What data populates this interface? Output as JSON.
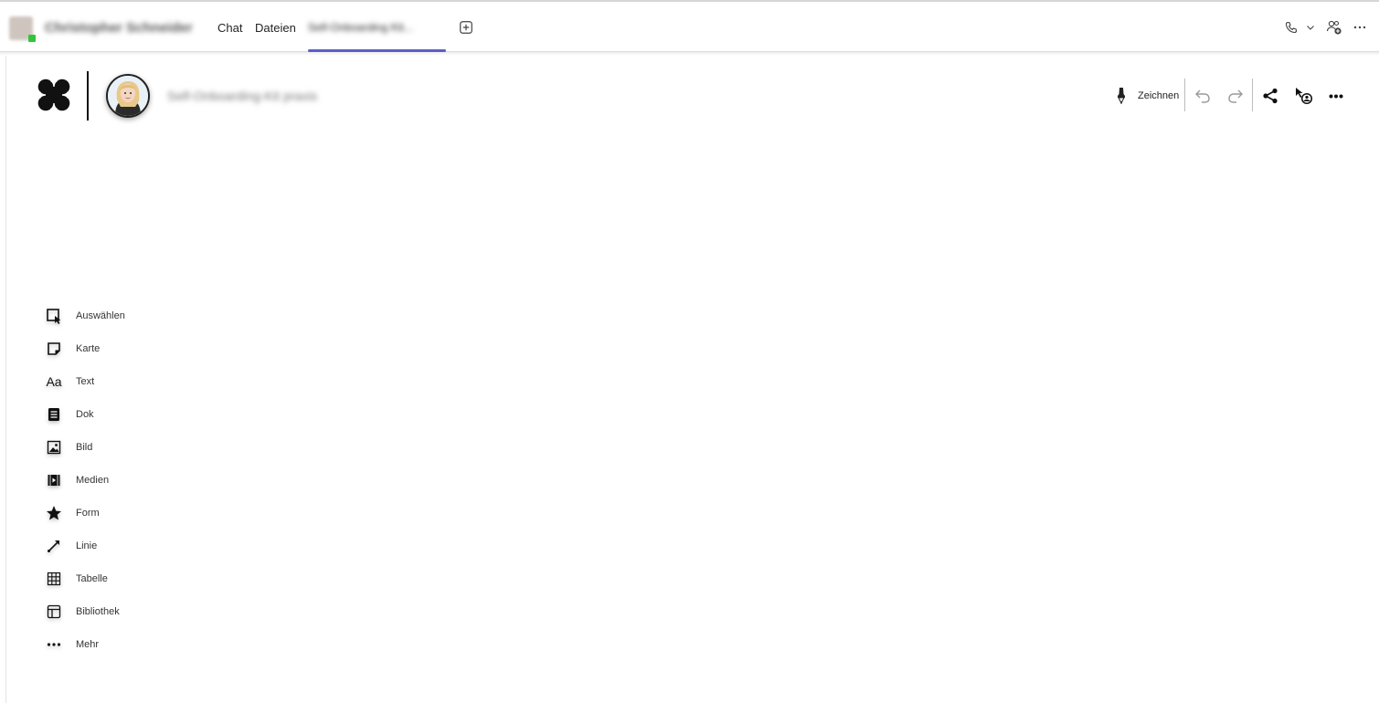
{
  "header": {
    "contact_name": "Christopher Schneider",
    "tabs": [
      {
        "label": "Chat"
      },
      {
        "label": "Dateien"
      },
      {
        "label": "Self-Onboarding Kit..."
      }
    ],
    "add_tab_icon": "plus-square-icon",
    "call_icon": "phone-icon",
    "call_dropdown_icon": "chevron-down-icon",
    "people_icon": "add-people-icon",
    "more_icon": "ellipsis-icon",
    "accent_color": "#5b5fc7",
    "presence_color": "#33c43a"
  },
  "board": {
    "title": "Self-Onboarding-Kit praxis",
    "logo_icon": "four-circles-logo",
    "toolbar": {
      "draw_label": "Zeichnen",
      "draw_icon": "pen-icon",
      "undo_icon": "undo-icon",
      "redo_icon": "redo-icon",
      "share_icon": "share-icon",
      "follow_icon": "cursor-person-icon",
      "more_icon": "ellipsis-icon"
    }
  },
  "tools": [
    {
      "label": "Auswählen",
      "icon": "select-icon"
    },
    {
      "label": "Karte",
      "icon": "card-icon"
    },
    {
      "label": "Text",
      "icon": "text-icon"
    },
    {
      "label": "Dok",
      "icon": "document-icon"
    },
    {
      "label": "Bild",
      "icon": "image-icon"
    },
    {
      "label": "Medien",
      "icon": "media-icon"
    },
    {
      "label": "Form",
      "icon": "star-icon"
    },
    {
      "label": "Linie",
      "icon": "line-icon"
    },
    {
      "label": "Tabelle",
      "icon": "table-icon"
    },
    {
      "label": "Bibliothek",
      "icon": "library-icon"
    },
    {
      "label": "Mehr",
      "icon": "more-dots-icon"
    }
  ],
  "tool_text_glyph": "Aa"
}
